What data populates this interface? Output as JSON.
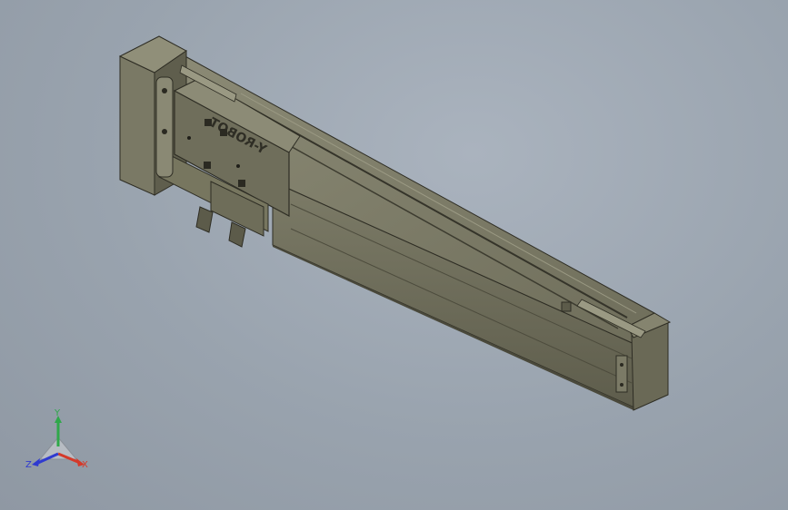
{
  "model": {
    "engraving": "Y-ROBOT",
    "body_color": "#6b6a58",
    "dark_color": "#3d3c30",
    "light_color": "#8a8974"
  },
  "triad": {
    "x_label": "X",
    "y_label": "Y",
    "z_label": "Z",
    "x_color": "#d43a2a",
    "y_color": "#2fa84a",
    "z_color": "#2f3ad0"
  }
}
